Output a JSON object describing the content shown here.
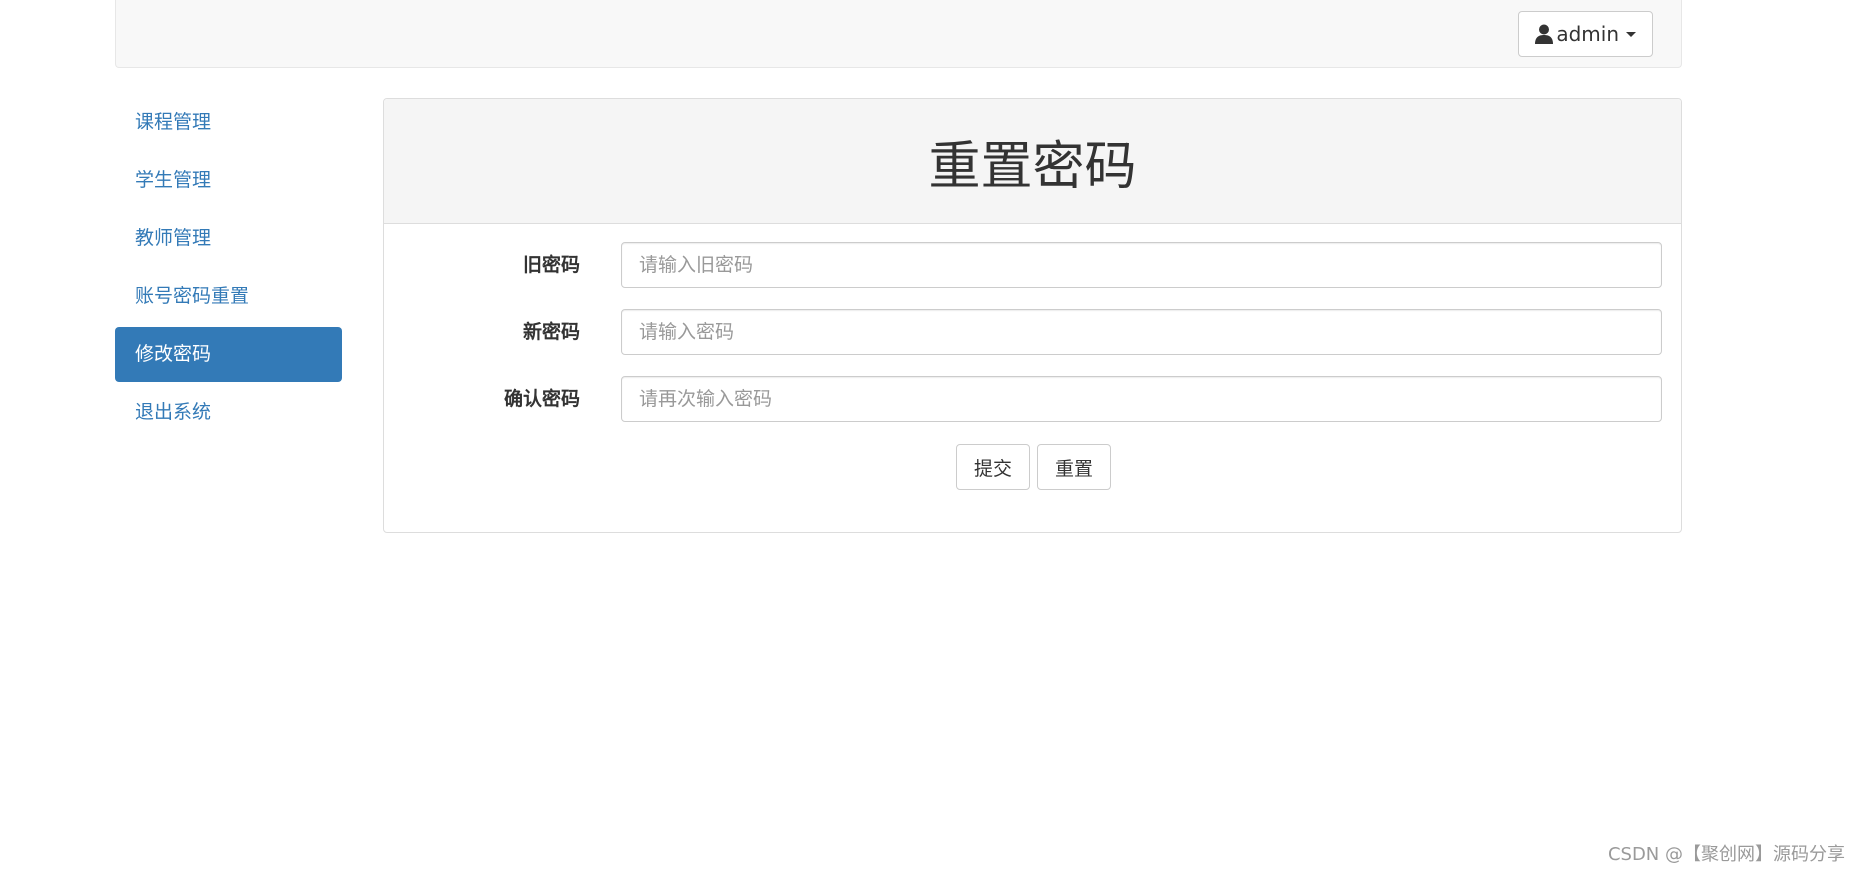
{
  "navbar": {
    "user_label": "admin",
    "user_icon": "user-icon"
  },
  "sidebar": {
    "items": [
      {
        "label": "课程管理",
        "active": false
      },
      {
        "label": "学生管理",
        "active": false
      },
      {
        "label": "教师管理",
        "active": false
      },
      {
        "label": "账号密码重置",
        "active": false
      },
      {
        "label": "修改密码",
        "active": true
      },
      {
        "label": "退出系统",
        "active": false
      }
    ]
  },
  "panel": {
    "title": "重置密码",
    "fields": [
      {
        "label": "旧密码",
        "value": "",
        "placeholder": "请输入旧密码"
      },
      {
        "label": "新密码",
        "value": "",
        "placeholder": "请输入密码"
      },
      {
        "label": "确认密码",
        "value": "",
        "placeholder": "请再次输入密码"
      }
    ],
    "submit_label": "提交",
    "reset_label": "重置"
  },
  "watermark": "CSDN @【聚创网】源码分享",
  "colors": {
    "primary": "#337ab7",
    "navbar_bg": "#f8f8f8",
    "panel_heading_bg": "#f5f5f5",
    "border": "#dddddd"
  }
}
